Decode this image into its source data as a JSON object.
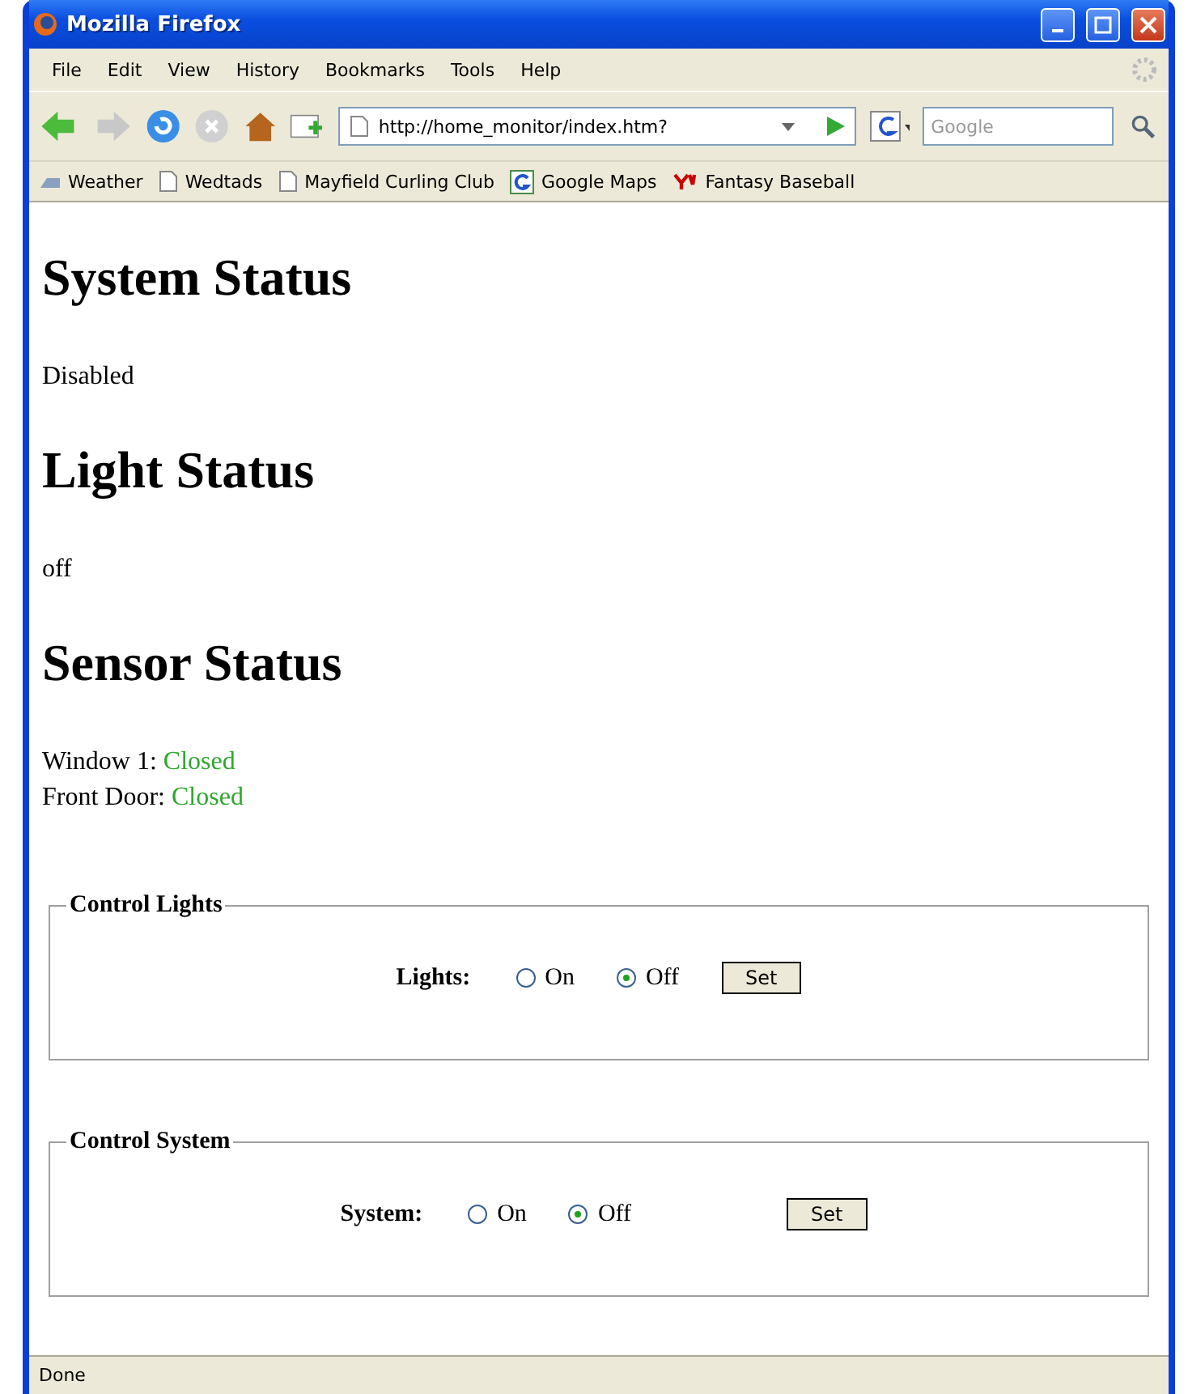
{
  "window": {
    "title": "Mozilla Firefox"
  },
  "menu": [
    "File",
    "Edit",
    "View",
    "History",
    "Bookmarks",
    "Tools",
    "Help"
  ],
  "toolbar": {
    "address": "http://home_monitor/index.htm?",
    "search_placeholder": "Google"
  },
  "bookmarks": [
    {
      "label": "Weather",
      "kind": "weather"
    },
    {
      "label": "Wedtads",
      "kind": "page"
    },
    {
      "label": "Mayfield Curling Club",
      "kind": "page"
    },
    {
      "label": "Google Maps",
      "kind": "google"
    },
    {
      "label": "Fantasy Baseball",
      "kind": "yahoo"
    }
  ],
  "sections": [
    {
      "heading": "System Status",
      "lines": [
        {
          "text": "Disabled"
        }
      ]
    },
    {
      "heading": "Light Status",
      "lines": [
        {
          "text": "off"
        }
      ]
    },
    {
      "heading": "Sensor Status",
      "lines": [
        {
          "text": "Window 1:",
          "status": "Closed",
          "color": "#2ea82e"
        },
        {
          "text": "Front Door:",
          "status": "Closed",
          "color": "#2ea82e"
        }
      ]
    }
  ],
  "controls": [
    {
      "legend": "Control Lights",
      "label": "Lights:",
      "options": [
        {
          "label": "On",
          "selected": false
        },
        {
          "label": "Off",
          "selected": true
        }
      ],
      "button": "Set"
    },
    {
      "legend": "Control System",
      "label": "System:",
      "options": [
        {
          "label": "On",
          "selected": false
        },
        {
          "label": "Off",
          "selected": true
        }
      ],
      "button": "Set"
    }
  ],
  "status_bar": "Done"
}
